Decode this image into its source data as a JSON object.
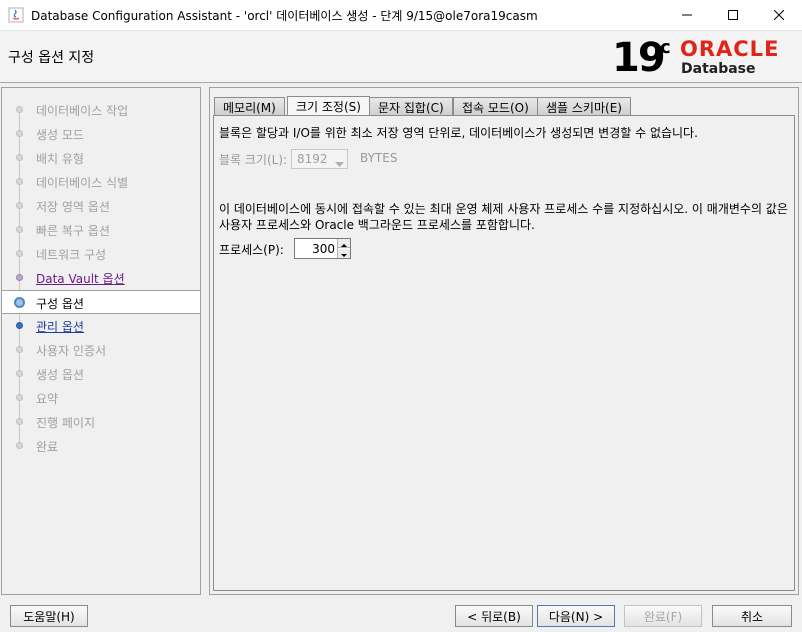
{
  "window": {
    "title": "Database Configuration Assistant - 'orcl' 데이터베이스 생성 - 단계 9/15@ole7ora19casm"
  },
  "header": {
    "page_title": "구성 옵션 지정",
    "brand": {
      "version": "19",
      "version_suffix": "c",
      "oracle": "ORACLE",
      "product": "Database"
    }
  },
  "nav": {
    "items": [
      {
        "label": "데이터베이스 작업",
        "state": "disabled"
      },
      {
        "label": "생성 모드",
        "state": "disabled"
      },
      {
        "label": "배치 유형",
        "state": "disabled"
      },
      {
        "label": "데이터베이스 식별",
        "state": "disabled"
      },
      {
        "label": "저장 영역 옵션",
        "state": "disabled"
      },
      {
        "label": "빠른 복구 옵션",
        "state": "disabled"
      },
      {
        "label": "네트워크 구성",
        "state": "disabled"
      },
      {
        "label": "Data Vault 옵션",
        "state": "visited"
      },
      {
        "label": "구성 옵션",
        "state": "active"
      },
      {
        "label": "관리 옵션",
        "state": "link"
      },
      {
        "label": "사용자 인증서",
        "state": "disabled"
      },
      {
        "label": "생성 옵션",
        "state": "disabled"
      },
      {
        "label": "요약",
        "state": "disabled"
      },
      {
        "label": "진행 페이지",
        "state": "disabled"
      },
      {
        "label": "완료",
        "state": "disabled"
      }
    ]
  },
  "tabs": [
    {
      "label": "메모리(M)"
    },
    {
      "label": "크기 조정(S)"
    },
    {
      "label": "문자 집합(C)"
    },
    {
      "label": "접속 모드(O)"
    },
    {
      "label": "샘플 스키마(E)"
    }
  ],
  "sizing": {
    "block_info": "블록은 할당과 I/O를 위한 최소 저장 영역 단위로, 데이터베이스가 생성되면 변경할 수 없습니다.",
    "block_size_label": "블록 크기(L):",
    "block_size_value": "8192",
    "block_size_unit": "BYTES",
    "process_info_line1": "이 데이터베이스에 동시에 접속할 수 있는 최대 운영 체제 사용자 프로세스 수를 지정하십시오. 이 매개변수의 값은",
    "process_info_line2": "사용자 프로세스와 Oracle 백그라운드 프로세스를 포함합니다.",
    "process_label": "프로세스(P):",
    "process_value": "300"
  },
  "footer": {
    "help": "도움말(H)",
    "back": "< 뒤로(B)",
    "next": "다음(N) >",
    "finish": "완료(F)",
    "cancel": "취소"
  }
}
